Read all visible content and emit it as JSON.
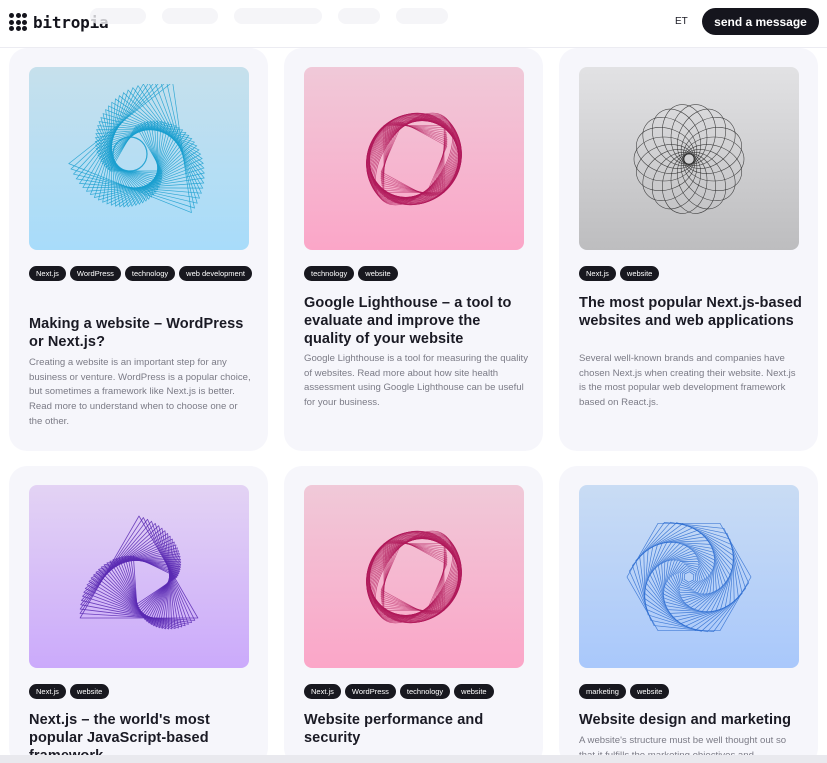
{
  "header": {
    "brand": "bitropia",
    "lang": "ET",
    "cta_label": "send a message"
  },
  "colors": {
    "card_bg": "#f6f6fb",
    "tag_bg": "#18181f",
    "cta_bg": "#15151d"
  },
  "cards": [
    {
      "tags": [
        "Next.js",
        "WordPress",
        "technology",
        "web development"
      ],
      "title": "Making a website – WordPress or Next.js?",
      "excerpt": "Creating a website is an important step for any business or venture. WordPress is a popular choice, but sometimes a framework like Next.js is better. Read more to understand when to choose one or the other.",
      "image_icon": "blue-wave-triangle-art"
    },
    {
      "tags": [
        "technology",
        "website"
      ],
      "title": "Google Lighthouse – a tool to evaluate and improve the quality of your website",
      "excerpt": "Google Lighthouse is a tool for measuring the quality of websites. Read more about how site health assessment using Google Lighthouse can be useful for your business.",
      "image_icon": "pink-twisted-square-art"
    },
    {
      "tags": [
        "Next.js",
        "website"
      ],
      "title": "The most popular Next.js-based websites and web applications",
      "excerpt": "Several well-known brands and companies have chosen Next.js when creating their website. Next.js is the most popular web development framework based on React.js.",
      "image_icon": "gray-circle-spiral-art"
    },
    {
      "tags": [
        "Next.js",
        "website"
      ],
      "title": "Next.js – the world's most popular JavaScript-based framework",
      "excerpt": "",
      "image_icon": "purple-rounded-triangle-art"
    },
    {
      "tags": [
        "Next.js",
        "WordPress",
        "technology",
        "website"
      ],
      "title": "Website performance and security",
      "excerpt": "",
      "image_icon": "pink-twisted-square-art"
    },
    {
      "tags": [
        "marketing",
        "website"
      ],
      "title": "Website design and marketing",
      "excerpt": "A website's structure must be well thought out so that it fulfills the marketing objectives and",
      "image_icon": "blue-hexagon-spiral-art"
    }
  ]
}
